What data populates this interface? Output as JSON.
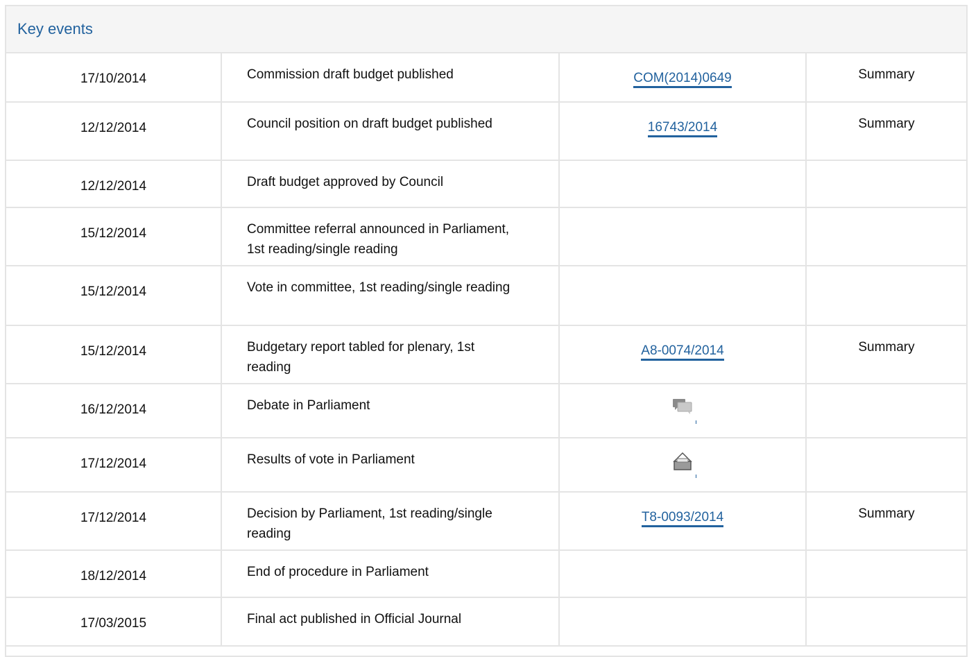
{
  "panel": {
    "title": "Key events"
  },
  "events": [
    {
      "date": "17/10/2014",
      "event": "Commission draft budget published",
      "doc": "COM(2014)0649",
      "summary": "Summary"
    },
    {
      "date": "12/12/2014",
      "event": "Council position on draft budget published",
      "doc": "16743/2014",
      "summary": "Summary"
    },
    {
      "date": "12/12/2014",
      "event": "Draft budget approved by Council",
      "doc": "",
      "summary": ""
    },
    {
      "date": "15/12/2014",
      "event": "Committee referral announced in Parliament, 1st reading/single reading",
      "doc": "",
      "summary": ""
    },
    {
      "date": "15/12/2014",
      "event": "Vote in committee, 1st reading/single reading",
      "doc": "",
      "summary": ""
    },
    {
      "date": "15/12/2014",
      "event": "Budgetary report tabled for plenary, 1st reading",
      "doc": "A8-0074/2014",
      "summary": "Summary"
    },
    {
      "date": "16/12/2014",
      "event": "Debate in Parliament",
      "icon": "debate-icon",
      "summary": ""
    },
    {
      "date": "17/12/2014",
      "event": "Results of vote in Parliament",
      "icon": "vote-results-icon",
      "summary": ""
    },
    {
      "date": "17/12/2014",
      "event": "Decision by Parliament, 1st reading/single reading",
      "doc": "T8-0093/2014",
      "summary": "Summary"
    },
    {
      "date": "18/12/2014",
      "event": "End of procedure in Parliament",
      "doc": "",
      "summary": ""
    },
    {
      "date": "17/03/2015",
      "event": "Final act published in Official Journal",
      "doc": "",
      "summary": ""
    }
  ],
  "colors": {
    "link": "#22629e",
    "border": "#e4e4e4",
    "header_bg": "#f5f5f5"
  }
}
